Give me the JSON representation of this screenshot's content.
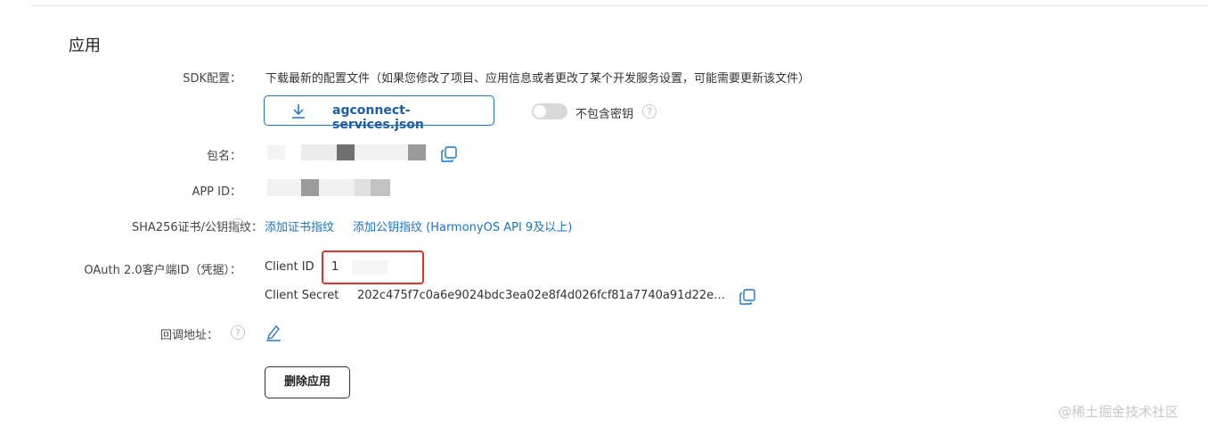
{
  "section": {
    "title": "应用"
  },
  "sdk": {
    "label": "SDK配置：",
    "description": "下载最新的配置文件（如果您修改了项目、应用信息或者更改了某个开发服务设置，可能需要更新该文件）",
    "download_label": "agconnect-services.json",
    "toggle_label": "不包含密钥",
    "toggle_on": false
  },
  "package": {
    "label": "包名："
  },
  "app_id": {
    "label": "APP ID："
  },
  "sha256": {
    "label": "SHA256证书/公钥指纹：",
    "add_cert_link": "添加证书指纹",
    "add_pubkey_link": "添加公钥指纹 (HarmonyOS API 9及以上)"
  },
  "oauth": {
    "label": "OAuth 2.0客户端ID（凭据）：",
    "client_id_label": "Client ID",
    "client_id_value": "1",
    "client_secret_label": "Client Secret",
    "client_secret_value": "202c475f7c0a6e9024bdc3ea02e8f4d026fcf81a7740a91d22e…"
  },
  "callback": {
    "label": "回调地址："
  },
  "actions": {
    "delete_label": "删除应用"
  },
  "watermark": "@稀土掘金技术社区",
  "colors": {
    "link": "#1a73c9",
    "highlight_box": "#e0312a",
    "toggle_off": "#d9d9d9"
  },
  "icons": [
    "download-icon",
    "help-icon",
    "copy-icon",
    "edit-icon"
  ]
}
